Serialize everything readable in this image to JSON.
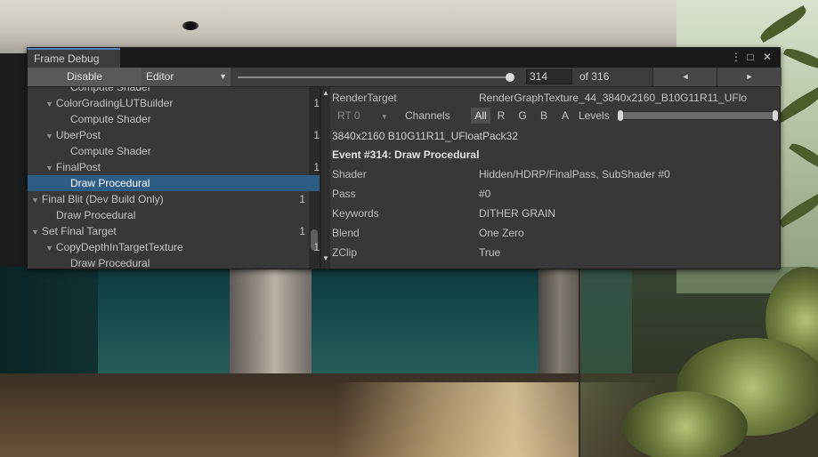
{
  "window": {
    "tab_title": "Frame Debug",
    "controls": {
      "menu": "⋮",
      "maximize": "□",
      "close": "✕"
    }
  },
  "toolbar": {
    "disable_label": "Disable",
    "target_dropdown": "Editor",
    "frame_slider": {
      "value": 314,
      "max": 316
    },
    "frame_input_value": "314",
    "of_label": "of 316",
    "prev_icon": "◄",
    "next_icon": "►"
  },
  "tree": {
    "items": [
      {
        "label": "Compute Shader",
        "level": 3,
        "count": "",
        "expandable": false,
        "selected": false
      },
      {
        "label": "ColorGradingLUTBuilder",
        "level": 2,
        "count": "1",
        "expandable": true,
        "selected": false
      },
      {
        "label": "Compute Shader",
        "level": 3,
        "count": "",
        "expandable": false,
        "selected": false
      },
      {
        "label": "UberPost",
        "level": 2,
        "count": "1",
        "expandable": true,
        "selected": false
      },
      {
        "label": "Compute Shader",
        "level": 3,
        "count": "",
        "expandable": false,
        "selected": false
      },
      {
        "label": "FinalPost",
        "level": 2,
        "count": "1",
        "expandable": true,
        "selected": false
      },
      {
        "label": "Draw Procedural",
        "level": 3,
        "count": "",
        "expandable": false,
        "selected": true
      },
      {
        "label": "Final Blit (Dev Build Only)",
        "level": 1,
        "count": "1",
        "expandable": true,
        "selected": false
      },
      {
        "label": "Draw Procedural",
        "level": 2,
        "count": "",
        "expandable": false,
        "selected": false
      },
      {
        "label": "Set Final Target",
        "level": 1,
        "count": "1",
        "expandable": true,
        "selected": false
      },
      {
        "label": "CopyDepthInTargetTexture",
        "level": 2,
        "count": "1",
        "expandable": true,
        "selected": false
      },
      {
        "label": "Draw Procedural",
        "level": 3,
        "count": "",
        "expandable": false,
        "selected": false
      }
    ]
  },
  "details": {
    "render_target": {
      "key": "RenderTarget",
      "value": "RenderGraphTexture_44_3840x2160_B10G11R11_UFlo"
    },
    "rt_select": "RT 0",
    "channels_label": "Channels",
    "channels": [
      "All",
      "R",
      "G",
      "B",
      "A"
    ],
    "active_channel": "All",
    "levels_label": "Levels",
    "format": "3840x2160 B10G11R11_UFloatPack32",
    "event_title": "Event #314: Draw Procedural",
    "properties": [
      {
        "key": "Shader",
        "value": "Hidden/HDRP/FinalPass, SubShader #0"
      },
      {
        "key": "Pass",
        "value": "#0"
      },
      {
        "key": "Keywords",
        "value": "DITHER GRAIN"
      },
      {
        "key": "Blend",
        "value": "One Zero"
      },
      {
        "key": "ZClip",
        "value": "True"
      }
    ]
  }
}
